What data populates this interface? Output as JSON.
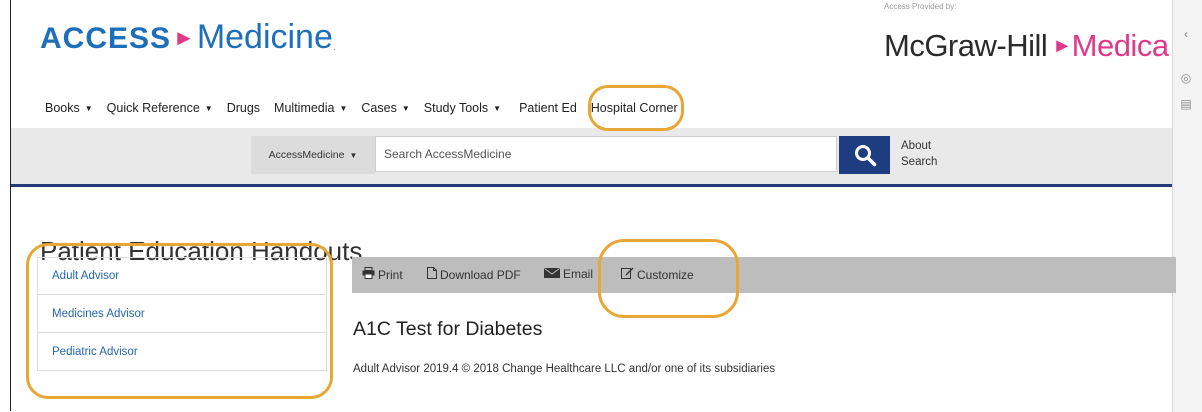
{
  "header": {
    "logo_left": {
      "part1": "ACCESS",
      "part2": "Medicine",
      "dot": "."
    },
    "provided_by": "Access Provided by:",
    "logo_right": {
      "part1": "McGraw-Hill",
      "part2": "Medica"
    }
  },
  "nav": {
    "items": [
      {
        "label": "Books",
        "dropdown": true
      },
      {
        "label": "Quick Reference",
        "dropdown": true
      },
      {
        "label": "Drugs",
        "dropdown": false
      },
      {
        "label": "Multimedia",
        "dropdown": true
      },
      {
        "label": "Cases",
        "dropdown": true
      },
      {
        "label": "Study Tools",
        "dropdown": true
      },
      {
        "label": "Patient Ed",
        "dropdown": false
      },
      {
        "label": "Hospital Corner",
        "dropdown": false
      }
    ]
  },
  "search": {
    "scope": "AccessMedicine",
    "placeholder": "Search AccessMedicine",
    "about_line1": "About",
    "about_line2": "Search"
  },
  "page_title": "Patient Education Handouts",
  "sidebar": {
    "items": [
      "Adult Advisor",
      "Medicines Advisor",
      "Pediatric Advisor"
    ]
  },
  "toolbar": {
    "print": "Print",
    "download": "Download PDF",
    "email": "Email",
    "customize": "Customize"
  },
  "article": {
    "title": "A1C Test for Diabetes",
    "meta": "Adult Advisor 2019.4 © 2018 Change Healthcare LLC and/or one of its subsidiaries"
  },
  "colors": {
    "brand_blue": "#1c6fb8",
    "brand_pink": "#e0398a",
    "nav_rule": "#243b7a",
    "search_button": "#1e3d80",
    "highlight": "#e8a634"
  }
}
